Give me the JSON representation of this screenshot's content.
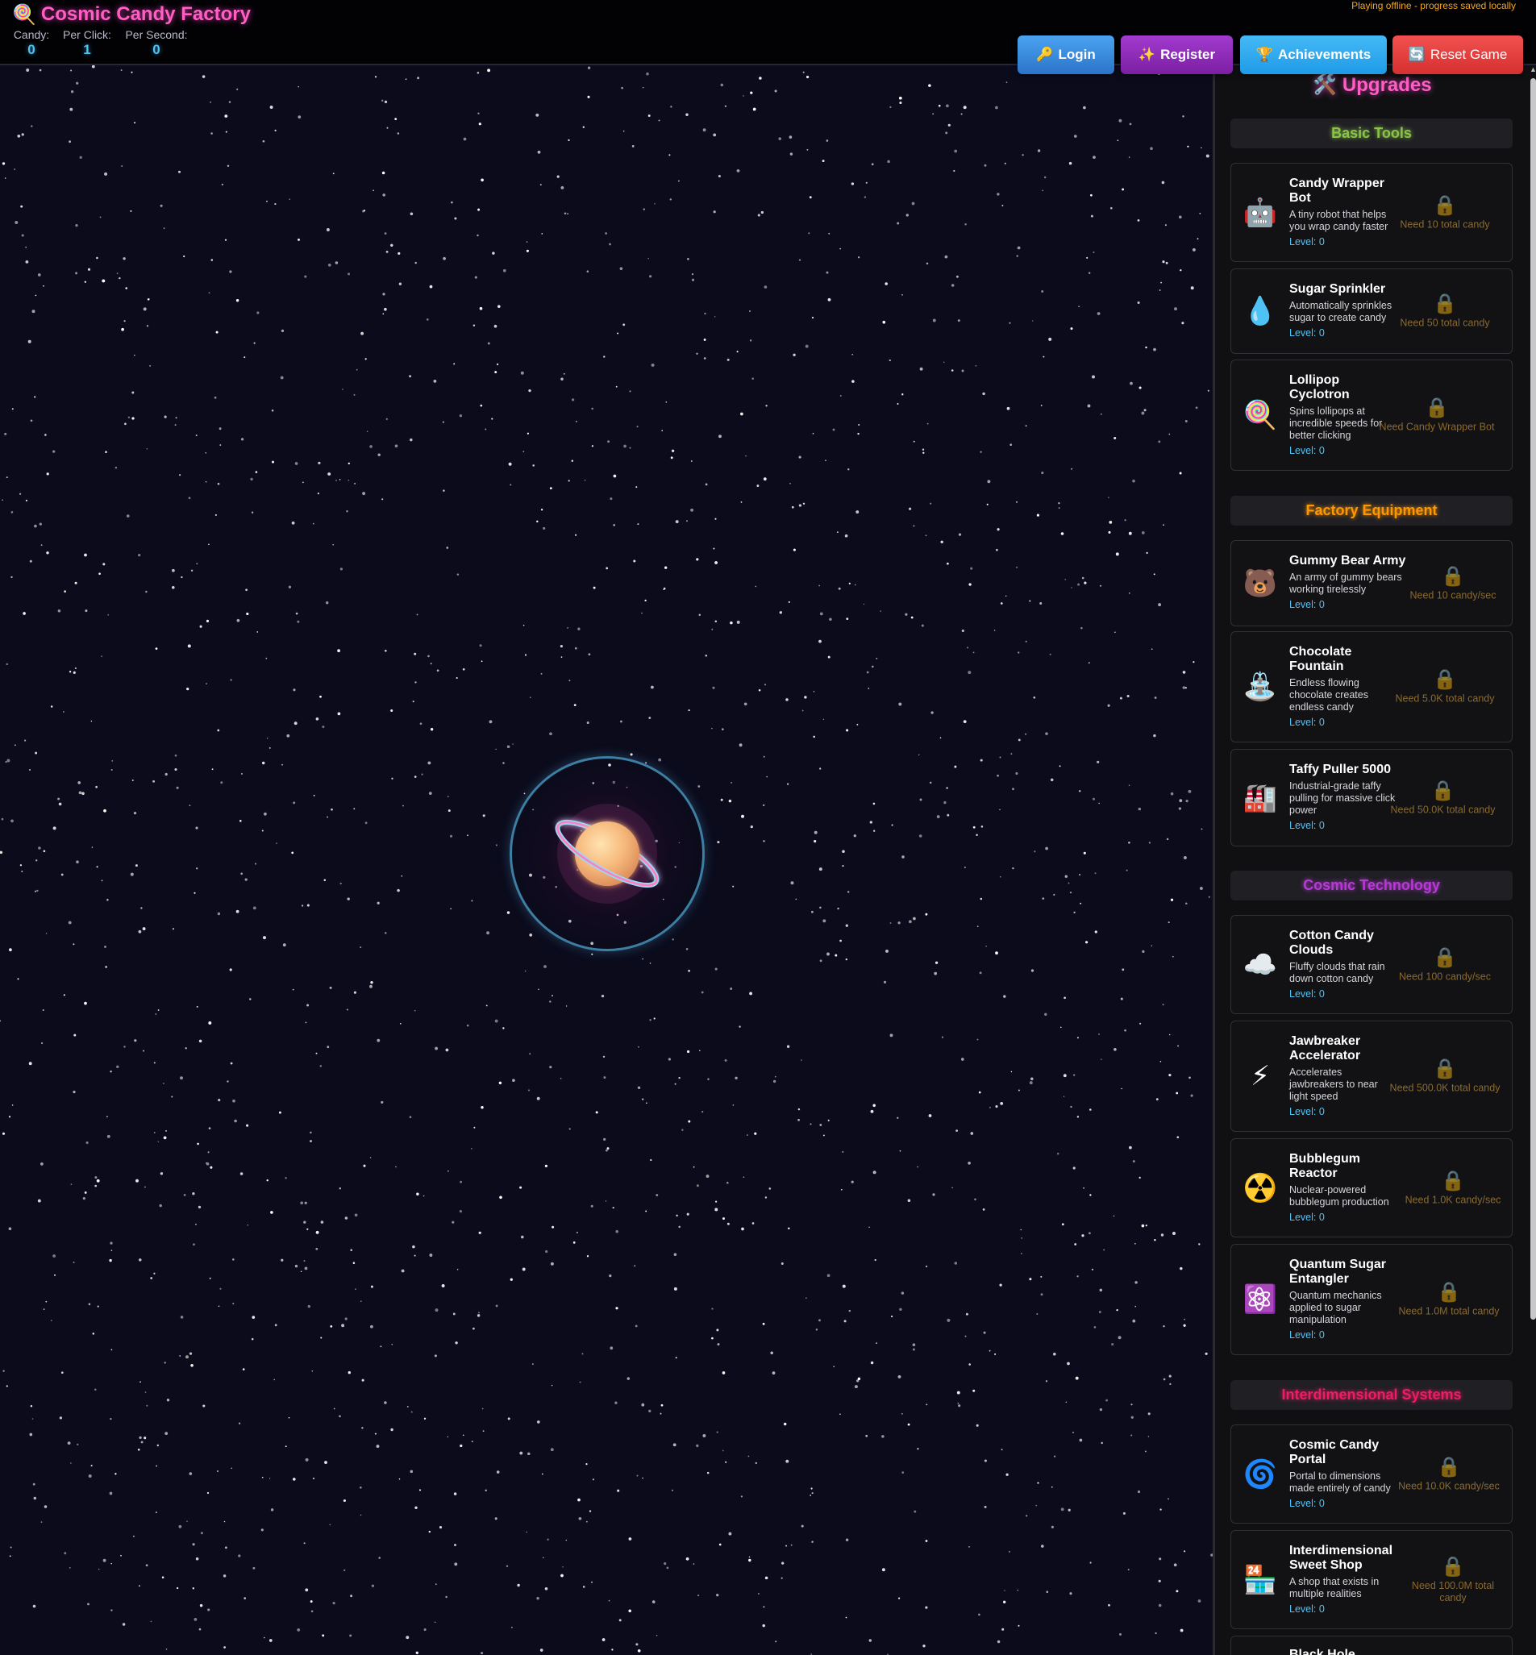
{
  "header": {
    "title": "Cosmic Candy Factory",
    "logo_icon": "🍭",
    "stats": [
      {
        "label": "Candy:",
        "value": "0"
      },
      {
        "label": "Per Click:",
        "value": "1"
      },
      {
        "label": "Per Second:",
        "value": "0"
      }
    ],
    "offline_notice": "Playing offline - progress saved locally",
    "buttons": {
      "login": {
        "icon": "🔑",
        "label": "Login"
      },
      "register": {
        "icon": "✨",
        "label": "Register"
      },
      "achievements": {
        "icon": "🏆",
        "label": "Achievements"
      },
      "reset": {
        "icon": "🔄",
        "label": "Reset Game"
      }
    }
  },
  "sidebar": {
    "title": "🛠️ Upgrades",
    "categories": [
      {
        "name": "Basic Tools",
        "color": "#8bc34a"
      },
      {
        "name": "Factory Equipment",
        "color": "#ff9800"
      },
      {
        "name": "Cosmic Technology",
        "color": "#b83ad6"
      },
      {
        "name": "Interdimensional Systems",
        "color": "#e91e63"
      }
    ],
    "upgrades": [
      {
        "icon": "🤖",
        "name": "Candy Wrapper Bot",
        "desc": "A tiny robot that helps you wrap candy faster",
        "level": "Level: 0",
        "lock": "🔒",
        "req": "Need 10 total candy"
      },
      {
        "icon": "💧",
        "name": "Sugar Sprinkler",
        "desc": "Automatically sprinkles sugar to create candy",
        "level": "Level: 0",
        "lock": "🔒",
        "req": "Need 50 total candy"
      },
      {
        "icon": "🍭",
        "name": "Lollipop Cyclotron",
        "desc": "Spins lollipops at incredible speeds for better clicking",
        "level": "Level: 0",
        "lock": "🔒",
        "req": "Need Candy Wrapper Bot"
      },
      {
        "icon": "🐻",
        "name": "Gummy Bear Army",
        "desc": "An army of gummy bears working tirelessly",
        "level": "Level: 0",
        "lock": "🔒",
        "req": "Need 10 candy/sec"
      },
      {
        "icon": "⛲",
        "name": "Chocolate Fountain",
        "desc": "Endless flowing chocolate creates endless candy",
        "level": "Level: 0",
        "lock": "🔒",
        "req": "Need 5.0K total candy"
      },
      {
        "icon": "🏭",
        "name": "Taffy Puller 5000",
        "desc": "Industrial-grade taffy pulling for massive click power",
        "level": "Level: 0",
        "lock": "🔒",
        "req": "Need 50.0K total candy"
      },
      {
        "icon": "☁️",
        "name": "Cotton Candy Clouds",
        "desc": "Fluffy clouds that rain down cotton candy",
        "level": "Level: 0",
        "lock": "🔒",
        "req": "Need 100 candy/sec"
      },
      {
        "icon": "⚡",
        "name": "Jawbreaker Accelerator",
        "desc": "Accelerates jawbreakers to near light speed",
        "level": "Level: 0",
        "lock": "🔒",
        "req": "Need 500.0K total candy"
      },
      {
        "icon": "☢️",
        "name": "Bubblegum Reactor",
        "desc": "Nuclear-powered bubblegum production",
        "level": "Level: 0",
        "lock": "🔒",
        "req": "Need 1.0K candy/sec"
      },
      {
        "icon": "⚛️",
        "name": "Quantum Sugar Entangler",
        "desc": "Quantum mechanics applied to sugar manipulation",
        "level": "Level: 0",
        "lock": "🔒",
        "req": "Need 1.0M total candy"
      },
      {
        "icon": "🌀",
        "name": "Cosmic Candy Portal",
        "desc": "Portal to dimensions made entirely of candy",
        "level": "Level: 0",
        "lock": "🔒",
        "req": "Need 10.0K candy/sec"
      },
      {
        "icon": "🏪",
        "name": "Interdimensional Sweet Shop",
        "desc": "A shop that exists in multiple realities",
        "level": "Level: 0",
        "lock": "🔒",
        "req": "Need 100.0M total candy"
      },
      {
        "icon": "",
        "name": "Black Hole",
        "desc": "",
        "level": "",
        "lock": "",
        "req": ""
      }
    ]
  },
  "game": {
    "clickable_icon": "planet-icon"
  }
}
